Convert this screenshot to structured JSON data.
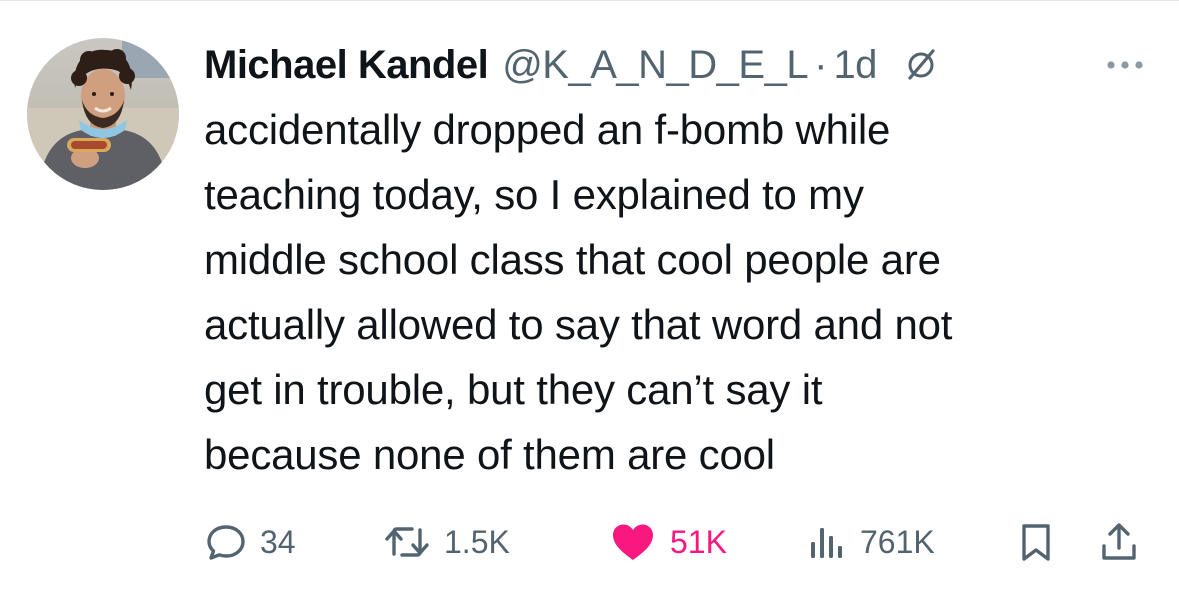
{
  "tweet": {
    "author": {
      "display_name": "Michael Kandel",
      "handle": "@K_A_N_D_E_L"
    },
    "separator": "·",
    "time_ago": "1d",
    "text_lines": [
      "accidentally dropped an f-bomb while",
      "teaching today, so I explained to my",
      "middle school class that cool people are",
      "actually allowed to say that word and not",
      "get in trouble, but they can’t say it",
      "because none of them are cool"
    ],
    "metrics": {
      "replies": "34",
      "reposts": "1.5K",
      "likes": "51K",
      "views": "761K"
    },
    "colors": {
      "like_active": "#f91880",
      "secondary_text": "#536471",
      "primary_text": "#0f1419"
    },
    "icons": {
      "reply": "speech-bubble-icon",
      "repost": "repost-arrows-icon",
      "like": "heart-filled-icon",
      "views": "bar-chart-icon",
      "bookmark": "bookmark-icon",
      "share": "share-upload-icon",
      "more": "ellipsis-icon",
      "header_badge": "slashed-circle-icon"
    }
  }
}
